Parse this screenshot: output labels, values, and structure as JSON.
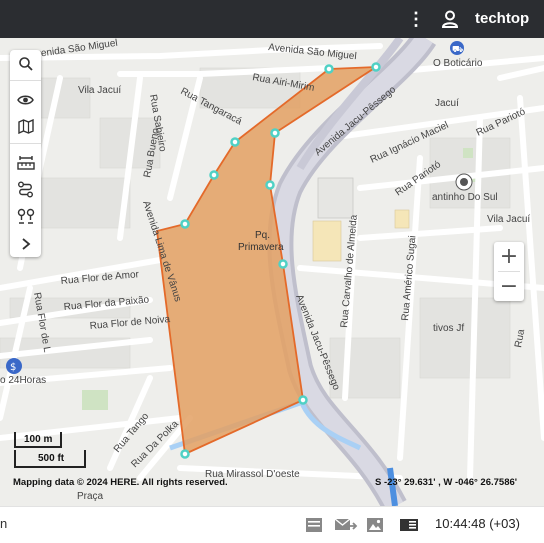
{
  "header": {
    "username": "techtop",
    "menu_icon": "kebab-menu-icon",
    "user_icon": "user-icon"
  },
  "map": {
    "street_labels": [
      "Avenida São Miguel",
      "Avenida São Miguel",
      "Vila Jacuí",
      "Rua Airi-Mirim",
      "Rua Tangaracá",
      "Rua Sabieiro",
      "Rua Bueno",
      "Avenida Jacu-Pêssego",
      "Rua Ignácio Maciel",
      "Rua Pariotó",
      "Rua Pariotó",
      "Vila Jacuí",
      "Jacuí",
      "Avenida Lima de Vânus",
      "Rua Flor de Amor",
      "Rua Flor da Paixão",
      "Rua Flor de Noiva",
      "Rua Flor de L",
      "Avenida Jacu-Pêssego",
      "Rua Carvalho de Almeida",
      "Rua Américo Sugai",
      "Rua Tango",
      "Rua Da Polka",
      "Rua Mirassol D'oeste",
      "Praça",
      "o 24Horas",
      "tivos Jf",
      "Rua"
    ],
    "poi_labels": [
      "O Boticário",
      "antinho Do Sul"
    ],
    "park_name": "Pq.\nPrimavera",
    "accent_color": "#e46a2a",
    "fill_color": "#e3a063",
    "vertex_color": "#4fd1c5"
  },
  "toolbar": {
    "items": [
      "search-icon",
      "eye-icon",
      "map-icon",
      "ruler-icon",
      "route-icon",
      "waypoints-icon",
      "chevron-right-icon"
    ]
  },
  "zoom": {
    "in_label": "+",
    "out_label": "−"
  },
  "scale": {
    "metric": "100 m",
    "imperial": "500 ft"
  },
  "attribution": "Mapping data © 2024 HERE. All rights reserved.",
  "coordinates": "S -23° 29.631' , W -046° 26.7586'",
  "statusbar": {
    "left_text": "n",
    "time": "10:44:48 (+03)",
    "icons": [
      "message-icon",
      "forward-mail-icon",
      "image-icon",
      "book-icon"
    ]
  }
}
